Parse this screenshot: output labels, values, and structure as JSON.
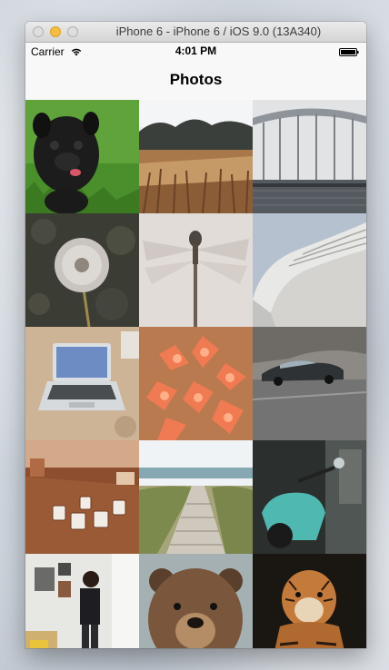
{
  "window": {
    "title": "iPhone 6 - iPhone 6 / iOS 9.0 (13A340)",
    "controls": [
      "close",
      "minimize",
      "zoom"
    ]
  },
  "status_bar": {
    "carrier": "Carrier",
    "time": "4:01 PM",
    "icons": [
      "wifi-icon",
      "battery-icon"
    ]
  },
  "nav_bar": {
    "title": "Photos"
  },
  "photos": [
    {
      "subject": "pug-puppy"
    },
    {
      "subject": "wheat-field"
    },
    {
      "subject": "pier-structure"
    },
    {
      "subject": "dandelion"
    },
    {
      "subject": "dragonfly"
    },
    {
      "subject": "curved-building"
    },
    {
      "subject": "laptop-desk"
    },
    {
      "subject": "orange-flowers"
    },
    {
      "subject": "classic-car"
    },
    {
      "subject": "coffee-cups"
    },
    {
      "subject": "beach-boardwalk"
    },
    {
      "subject": "scooter"
    },
    {
      "subject": "man-in-room"
    },
    {
      "subject": "bear"
    },
    {
      "subject": "tiger"
    }
  ]
}
